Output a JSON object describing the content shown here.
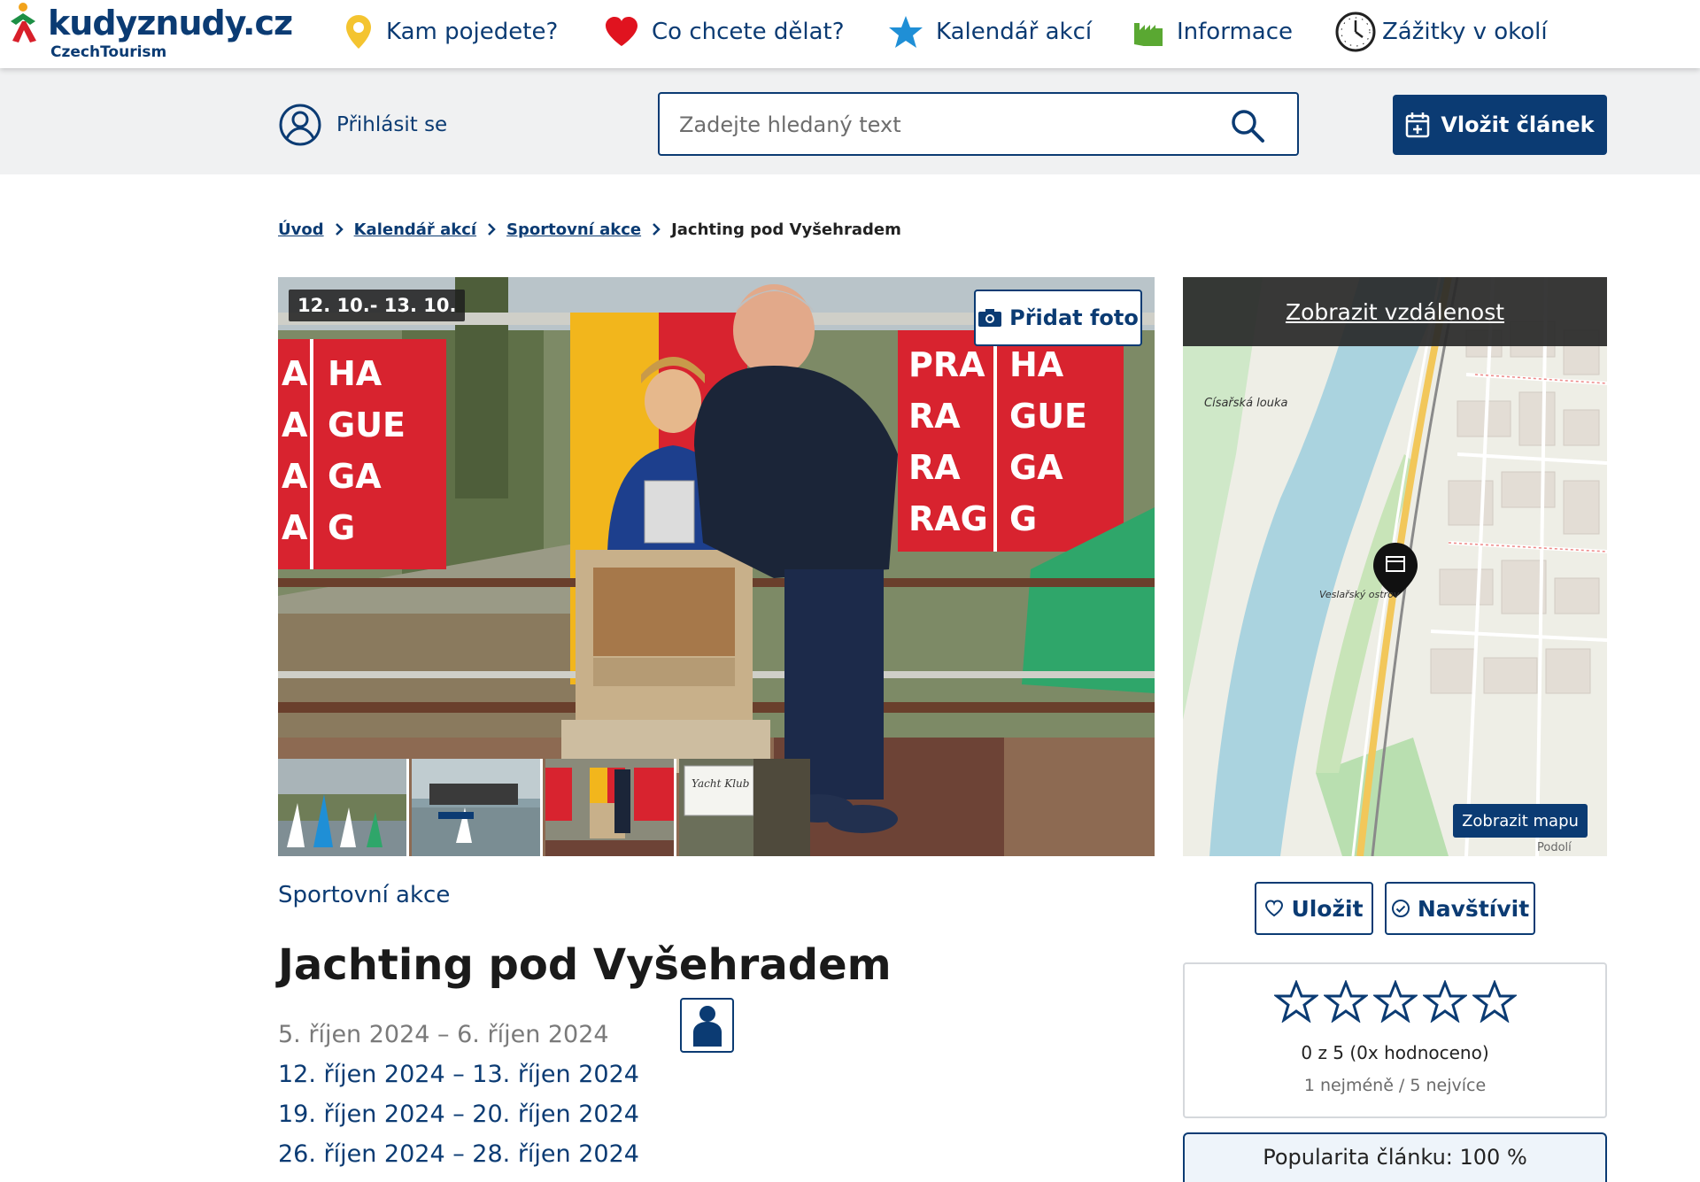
{
  "brand": {
    "name": "kudyznudy.cz",
    "sub": "CzechTourism"
  },
  "nav": {
    "items": [
      {
        "label": "Kam pojedete?",
        "icon": "location-pin-icon"
      },
      {
        "label": "Co chcete dělat?",
        "icon": "heart-icon"
      },
      {
        "label": "Kalendář akcí",
        "icon": "star-icon"
      },
      {
        "label": "Informace",
        "icon": "information-city-icon"
      },
      {
        "label": "Zážitky v okolí",
        "icon": "clock-icon"
      }
    ]
  },
  "util": {
    "login_label": "Přihlásit se",
    "search_placeholder": "Zadejte hledaný text",
    "add_article_label": "Vložit článek"
  },
  "breadcrumb": {
    "items": [
      "Úvod",
      "Kalendář akcí",
      "Sportovní akce"
    ],
    "current": "Jachting pod Vyšehradem"
  },
  "photo": {
    "date_badge": "12. 10.- 13. 10.",
    "add_photo_label": "Přidat foto",
    "banner_left": [
      "A",
      "HA",
      "A",
      "GUE",
      "A",
      "GA",
      "A",
      "G"
    ],
    "banner_right": [
      "PRA",
      "HA",
      "RA",
      "GUE",
      "RA",
      "GA",
      "RAG",
      "G"
    ],
    "thumbnail_sign": "Yacht Klub"
  },
  "map": {
    "distance_link": "Zobrazit vzdálenost",
    "show_map_label": "Zobrazit mapu",
    "labels": [
      "Císařská louka",
      "Veslařský ostrov",
      "Podolí"
    ]
  },
  "event": {
    "category": "Sportovní akce",
    "title": "Jachting pod Vyšehradem",
    "dates": [
      {
        "text": "5. říjen 2024 – 6. říjen 2024",
        "past": true
      },
      {
        "text": "12. říjen 2024 – 13. říjen 2024",
        "past": false
      },
      {
        "text": "19. říjen 2024 – 20. říjen 2024",
        "past": false
      },
      {
        "text": "26. říjen 2024 – 28. říjen 2024",
        "past": false
      }
    ]
  },
  "actions": {
    "save_label": "Uložit",
    "visit_label": "Navštívit"
  },
  "rating": {
    "value": 0,
    "max": 5,
    "text": "0 z 5 (0x hodnoceno)",
    "hint": "1 nejméně / 5 nejvíce"
  },
  "popularity": {
    "text": "Popularita článku: 100 %",
    "percent": 100
  },
  "colors": {
    "brand_blue": "#0b3b73",
    "banner_red": "#d8232f",
    "heart_red": "#e0131f",
    "star_blue": "#1f8fd6",
    "nav_green": "#5aa832"
  }
}
